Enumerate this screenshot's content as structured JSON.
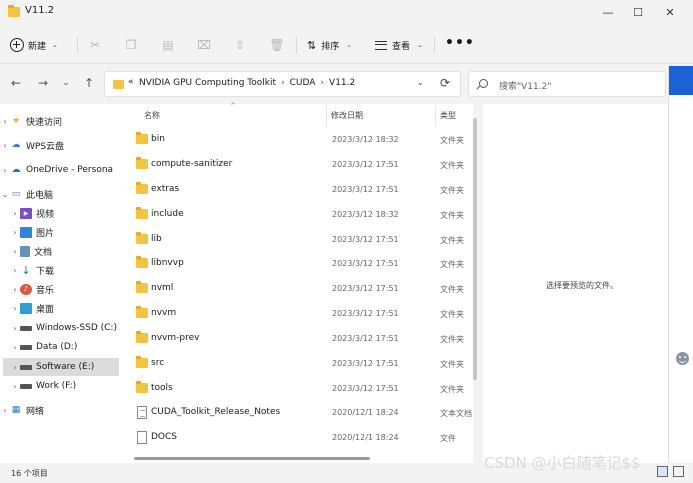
{
  "window": {
    "title": "V11.2",
    "minimize_glyph": "—",
    "maximize_glyph": "☐",
    "close_glyph": "✕"
  },
  "toolbar": {
    "new_label": "新建",
    "sort_label": "排序",
    "view_label": "查看",
    "more_glyph": "•••",
    "icons": [
      "cut-icon",
      "copy-icon",
      "paste-icon",
      "rename-icon",
      "share-icon",
      "delete-icon"
    ]
  },
  "nav": {
    "back": "←",
    "forward": "→",
    "recent": "⌄",
    "up": "↑"
  },
  "address": {
    "chevron": "«",
    "segments": [
      "NVIDIA GPU Computing Toolkit",
      "CUDA",
      "V11.2"
    ],
    "separator": "›",
    "dropdown": "⌄",
    "refresh": "⟳"
  },
  "search": {
    "placeholder": "搜索\"V11.2\""
  },
  "sidebar": {
    "items": [
      {
        "label": "快速访问",
        "icon": "star-icon"
      },
      {
        "label": "WPS云盘",
        "icon": "wps-cloud-icon"
      },
      {
        "label": "OneDrive - Persona",
        "icon": "onedrive-icon"
      },
      {
        "label": "此电脑",
        "icon": "computer-icon"
      },
      {
        "label": "视频",
        "icon": "video-icon"
      },
      {
        "label": "图片",
        "icon": "pictures-icon"
      },
      {
        "label": "文档",
        "icon": "documents-icon"
      },
      {
        "label": "下载",
        "icon": "download-icon"
      },
      {
        "label": "音乐",
        "icon": "music-icon"
      },
      {
        "label": "桌面",
        "icon": "desktop-icon"
      },
      {
        "label": "Windows-SSD (C:)",
        "icon": "windows-drive-icon"
      },
      {
        "label": "Data (D:)",
        "icon": "drive-icon"
      },
      {
        "label": "Software (E:)",
        "icon": "drive-icon"
      },
      {
        "label": "Work (F:)",
        "icon": "drive-icon"
      },
      {
        "label": "网络",
        "icon": "network-icon"
      }
    ]
  },
  "filelist": {
    "columns": {
      "name": "名称",
      "date": "修改日期",
      "type": "类型"
    },
    "sort_glyph": "^",
    "rows": [
      {
        "name": "bin",
        "date": "2023/3/12 18:32",
        "type": "文件夹",
        "kind": "folder"
      },
      {
        "name": "compute-sanitizer",
        "date": "2023/3/12 17:51",
        "type": "文件夹",
        "kind": "folder"
      },
      {
        "name": "extras",
        "date": "2023/3/12 17:51",
        "type": "文件夹",
        "kind": "folder"
      },
      {
        "name": "include",
        "date": "2023/3/12 18:32",
        "type": "文件夹",
        "kind": "folder"
      },
      {
        "name": "lib",
        "date": "2023/3/12 17:51",
        "type": "文件夹",
        "kind": "folder"
      },
      {
        "name": "libnvvp",
        "date": "2023/3/12 17:51",
        "type": "文件夹",
        "kind": "folder"
      },
      {
        "name": "nvml",
        "date": "2023/3/12 17:51",
        "type": "文件夹",
        "kind": "folder"
      },
      {
        "name": "nvvm",
        "date": "2023/3/12 17:51",
        "type": "文件夹",
        "kind": "folder"
      },
      {
        "name": "nvvm-prev",
        "date": "2023/3/12 17:51",
        "type": "文件夹",
        "kind": "folder"
      },
      {
        "name": "src",
        "date": "2023/3/12 17:51",
        "type": "文件夹",
        "kind": "folder"
      },
      {
        "name": "tools",
        "date": "2023/3/12 17:51",
        "type": "文件夹",
        "kind": "folder"
      },
      {
        "name": "CUDA_Toolkit_Release_Notes",
        "date": "2020/12/1 18:24",
        "type": "文本文档",
        "kind": "doc"
      },
      {
        "name": "DOCS",
        "date": "2020/12/1 18:24",
        "type": "文件",
        "kind": "blank"
      }
    ]
  },
  "preview": {
    "message": "选择要预览的文件。"
  },
  "status": {
    "count": "16 个项目"
  },
  "watermark": "CSDN @小白随笔记$$"
}
